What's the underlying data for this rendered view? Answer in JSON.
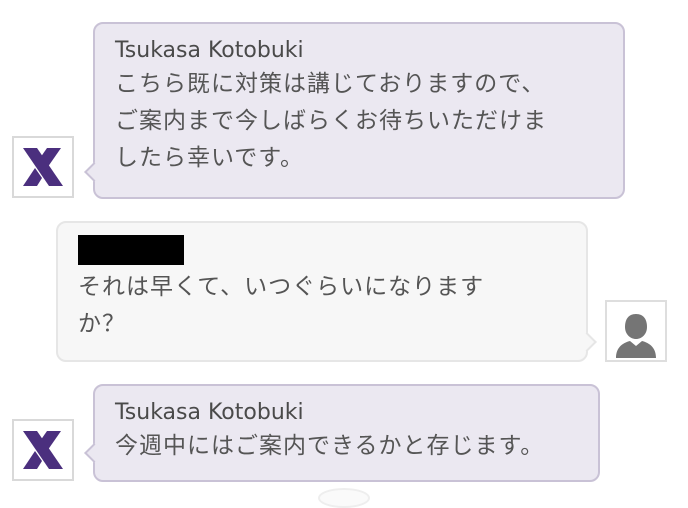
{
  "messages": [
    {
      "role": "staff",
      "sender": "Tsukasa Kotobuki",
      "lines": [
        "こちら既に対策は講じておりますので、",
        "ご案内まで今しばらくお待ちいただけま",
        "したら幸いです。"
      ]
    },
    {
      "role": "user",
      "lines": [
        "それは早くて、いつぐらいになります",
        "か？"
      ]
    },
    {
      "role": "staff",
      "sender": "Tsukasa Kotobuki",
      "lines": [
        "今週中にはご案内できるかと存じます。"
      ]
    }
  ],
  "icons": {
    "staff_avatar": "brand-x-logo-icon",
    "user_avatar": "person-silhouette-icon"
  },
  "colors": {
    "staff_bubble": "#ebe8f1",
    "staff_border": "#c9c2d6",
    "brand_purple": "#4b2f7e",
    "user_bubble": "#f7f7f7",
    "user_avatar": "#757575"
  }
}
